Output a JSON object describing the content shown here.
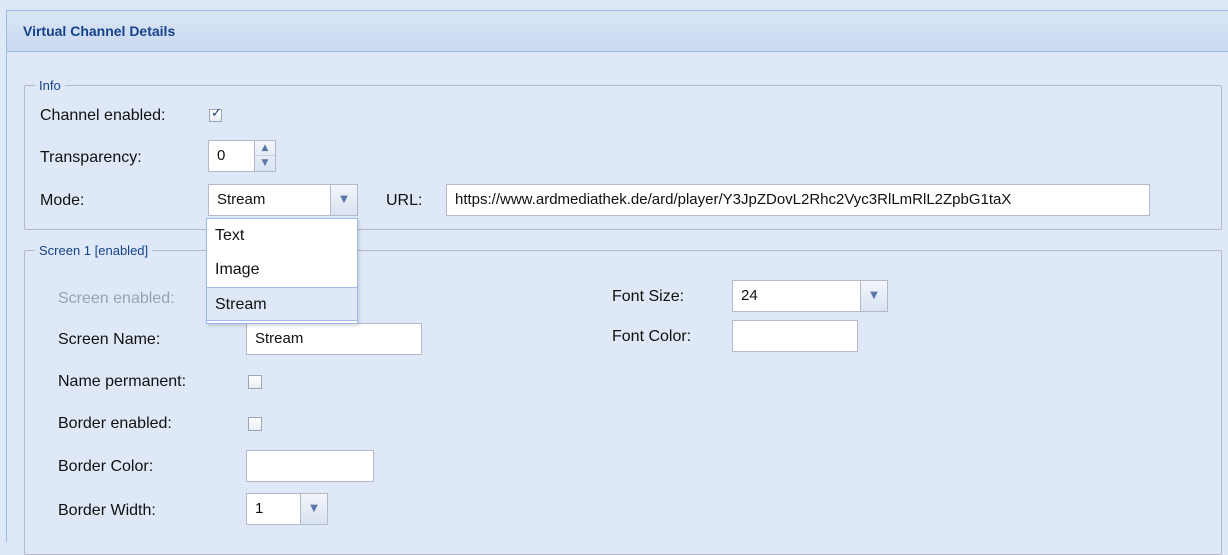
{
  "panel": {
    "title": "Virtual Channel Details"
  },
  "info": {
    "legend": "Info",
    "channel_enabled_label": "Channel enabled:",
    "channel_enabled": true,
    "transparency_label": "Transparency:",
    "transparency_value": "0",
    "mode_label": "Mode:",
    "mode_value": "Stream",
    "mode_options": [
      "Text",
      "Image",
      "Stream"
    ],
    "url_label": "URL:",
    "url_value": "https://www.ardmediathek.de/ard/player/Y3JpZDovL2Rhc2Vyc3RlLmRlL2ZpbG1taX"
  },
  "screen1": {
    "legend": "Screen 1 [enabled]",
    "screen_enabled_label": "Screen enabled:",
    "screen_name_label": "Screen Name:",
    "screen_name_value": "Stream",
    "name_permanent_label": "Name permanent:",
    "name_permanent": false,
    "border_enabled_label": "Border enabled:",
    "border_enabled": false,
    "border_color_label": "Border Color:",
    "border_color_value": "",
    "border_width_label": "Border Width:",
    "border_width_value": "1",
    "font_size_label": "Font Size:",
    "font_size_value": "24",
    "font_color_label": "Font Color:",
    "font_color_value": ""
  },
  "icons": {
    "checkbox_check": "check-icon",
    "combo_trigger": "chevron-down-icon",
    "spinner": "spinner-arrows-icon"
  },
  "colors": {
    "header_text": "#15428b",
    "background": "#dfe8f6",
    "border": "#99bbe8"
  }
}
